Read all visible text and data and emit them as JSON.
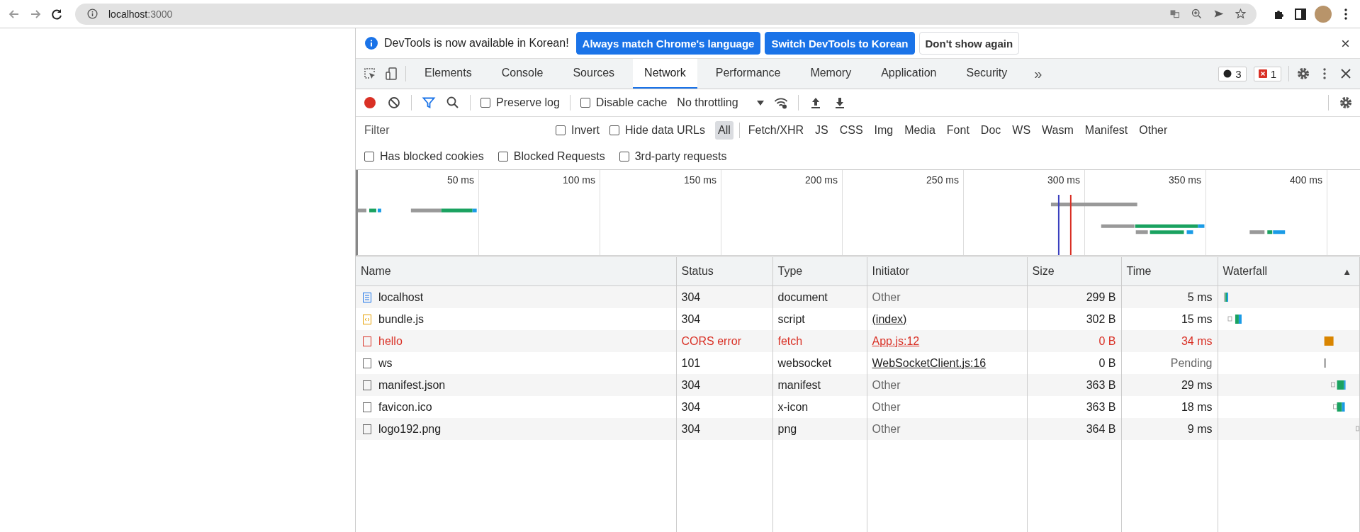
{
  "browser": {
    "host": "localhost",
    "port": ":3000"
  },
  "infobar": {
    "message": "DevTools is now available in Korean!",
    "buttons": [
      {
        "label": "Always match Chrome's language",
        "primary": true
      },
      {
        "label": "Switch DevTools to Korean",
        "primary": true
      },
      {
        "label": "Don't show again",
        "primary": false
      }
    ]
  },
  "tabs": [
    {
      "label": "Elements",
      "selected": false
    },
    {
      "label": "Console",
      "selected": false
    },
    {
      "label": "Sources",
      "selected": false
    },
    {
      "label": "Network",
      "selected": true
    },
    {
      "label": "Performance",
      "selected": false
    },
    {
      "label": "Memory",
      "selected": false
    },
    {
      "label": "Application",
      "selected": false
    },
    {
      "label": "Security",
      "selected": false
    }
  ],
  "more_tabs": "»",
  "badges": [
    {
      "kind": "messages",
      "count": "3"
    },
    {
      "kind": "errors",
      "count": "1"
    }
  ],
  "toolbar": {
    "recording": true,
    "preserve_log": {
      "label": "Preserve log",
      "checked": false
    },
    "disable_cache": {
      "label": "Disable cache",
      "checked": false
    },
    "throttling": "No throttling"
  },
  "filter": {
    "placeholder": "Filter",
    "checkboxes": [
      {
        "label": "Invert",
        "checked": false
      },
      {
        "label": "Hide data URLs",
        "checked": false
      }
    ],
    "types": [
      {
        "label": "All",
        "selected": true
      },
      {
        "label": "Fetch/XHR",
        "selected": false
      },
      {
        "label": "JS",
        "selected": false
      },
      {
        "label": "CSS",
        "selected": false
      },
      {
        "label": "Img",
        "selected": false
      },
      {
        "label": "Media",
        "selected": false
      },
      {
        "label": "Font",
        "selected": false
      },
      {
        "label": "Doc",
        "selected": false
      },
      {
        "label": "WS",
        "selected": false
      },
      {
        "label": "Wasm",
        "selected": false
      },
      {
        "label": "Manifest",
        "selected": false
      },
      {
        "label": "Other",
        "selected": false
      }
    ],
    "more_checkboxes": [
      {
        "label": "Has blocked cookies",
        "checked": false
      },
      {
        "label": "Blocked Requests",
        "checked": false
      },
      {
        "label": "3rd-party requests",
        "checked": false
      }
    ]
  },
  "timeline": {
    "ticks": [
      "50 ms",
      "100 ms",
      "150 ms",
      "200 ms",
      "250 ms",
      "300 ms",
      "350 ms",
      "400 ms"
    ]
  },
  "table": {
    "columns": [
      "Name",
      "Status",
      "Type",
      "Initiator",
      "Size",
      "Time",
      "Waterfall"
    ],
    "sort_indicator": "▲",
    "rows": [
      {
        "kind": "document",
        "name": "localhost",
        "status": "304",
        "type": "document",
        "initiator": "Other",
        "initiator_link": false,
        "size": "299 B",
        "time": "5 ms",
        "error": false,
        "pending": false
      },
      {
        "kind": "script",
        "name": "bundle.js",
        "status": "304",
        "type": "script",
        "initiator": "(index)",
        "initiator_link": true,
        "size": "302 B",
        "time": "15 ms",
        "error": false,
        "pending": false
      },
      {
        "kind": "other",
        "name": "hello",
        "status": "CORS error",
        "type": "fetch",
        "initiator": "App.js:12",
        "initiator_link": true,
        "size": "0 B",
        "time": "34 ms",
        "error": true,
        "pending": false
      },
      {
        "kind": "other",
        "name": "ws",
        "status": "101",
        "type": "websocket",
        "initiator": "WebSocketClient.js:16",
        "initiator_link": true,
        "size": "0 B",
        "time": "Pending",
        "error": false,
        "pending": true
      },
      {
        "kind": "other",
        "name": "manifest.json",
        "status": "304",
        "type": "manifest",
        "initiator": "Other",
        "initiator_link": false,
        "size": "363 B",
        "time": "29 ms",
        "error": false,
        "pending": false
      },
      {
        "kind": "other",
        "name": "favicon.ico",
        "status": "304",
        "type": "x-icon",
        "initiator": "Other",
        "initiator_link": false,
        "size": "363 B",
        "time": "18 ms",
        "error": false,
        "pending": false
      },
      {
        "kind": "other",
        "name": "logo192.png",
        "status": "304",
        "type": "png",
        "initiator": "Other",
        "initiator_link": false,
        "size": "364 B",
        "time": "9 ms",
        "error": false,
        "pending": false
      }
    ]
  }
}
